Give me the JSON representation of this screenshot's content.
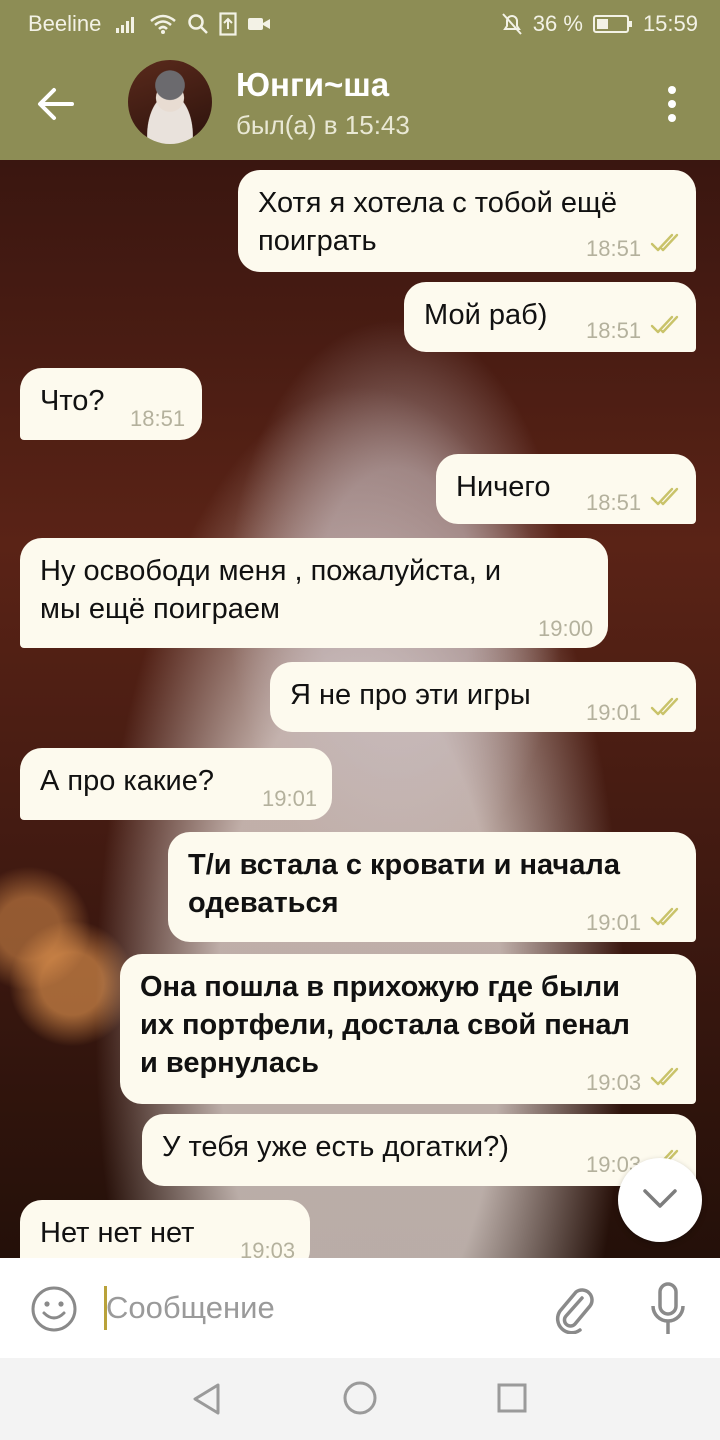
{
  "status_bar": {
    "carrier": "Beeline",
    "battery": "36 %",
    "time": "15:59",
    "icons": [
      "signal-icon",
      "wifi-icon",
      "search-icon",
      "upload-icon",
      "video-icon",
      "bell-muted-icon",
      "battery-icon"
    ]
  },
  "header": {
    "name": "Юнги~ша",
    "status": "был(а) в 15:43"
  },
  "messages": [
    {
      "side": "out",
      "text": [
        "Хотя я хотела с тобой ещё",
        "поиграть"
      ],
      "time": "18:51",
      "read": true
    },
    {
      "side": "out",
      "text": [
        "Мой раб)"
      ],
      "time": "18:51",
      "read": true
    },
    {
      "side": "in",
      "text": [
        "Что?"
      ],
      "time": "18:51"
    },
    {
      "side": "out",
      "text": [
        "Ничего"
      ],
      "time": "18:51",
      "read": true
    },
    {
      "side": "in",
      "text": [
        "Ну освободи меня , пожалуйста, и",
        "мы ещё поиграем"
      ],
      "time": "19:00"
    },
    {
      "side": "out",
      "text": [
        "Я не про эти игры"
      ],
      "time": "19:01",
      "read": true
    },
    {
      "side": "in",
      "text": [
        "А про какие?"
      ],
      "time": "19:01"
    },
    {
      "side": "out",
      "bold": true,
      "text": [
        "Т/и встала с кровати и начала",
        "одеваться"
      ],
      "time": "19:01",
      "read": true
    },
    {
      "side": "out",
      "bold": true,
      "text": [
        "Она пошла в прихожую где были",
        "их портфели, достала свой пенал",
        "и вернулась"
      ],
      "time": "19:03",
      "read": true
    },
    {
      "side": "out",
      "text": [
        "У тебя уже есть догатки?)"
      ],
      "time": "19:03",
      "read": true
    },
    {
      "side": "in",
      "text": [
        "Нет нет нет"
      ],
      "time": "19:03"
    }
  ],
  "input": {
    "placeholder": "Сообщение"
  },
  "colors": {
    "header_bg": "#8d8d55",
    "bubble_bg": "#fdfaee",
    "tick_color": "#c9c36a",
    "time_color": "#b4b19d"
  }
}
